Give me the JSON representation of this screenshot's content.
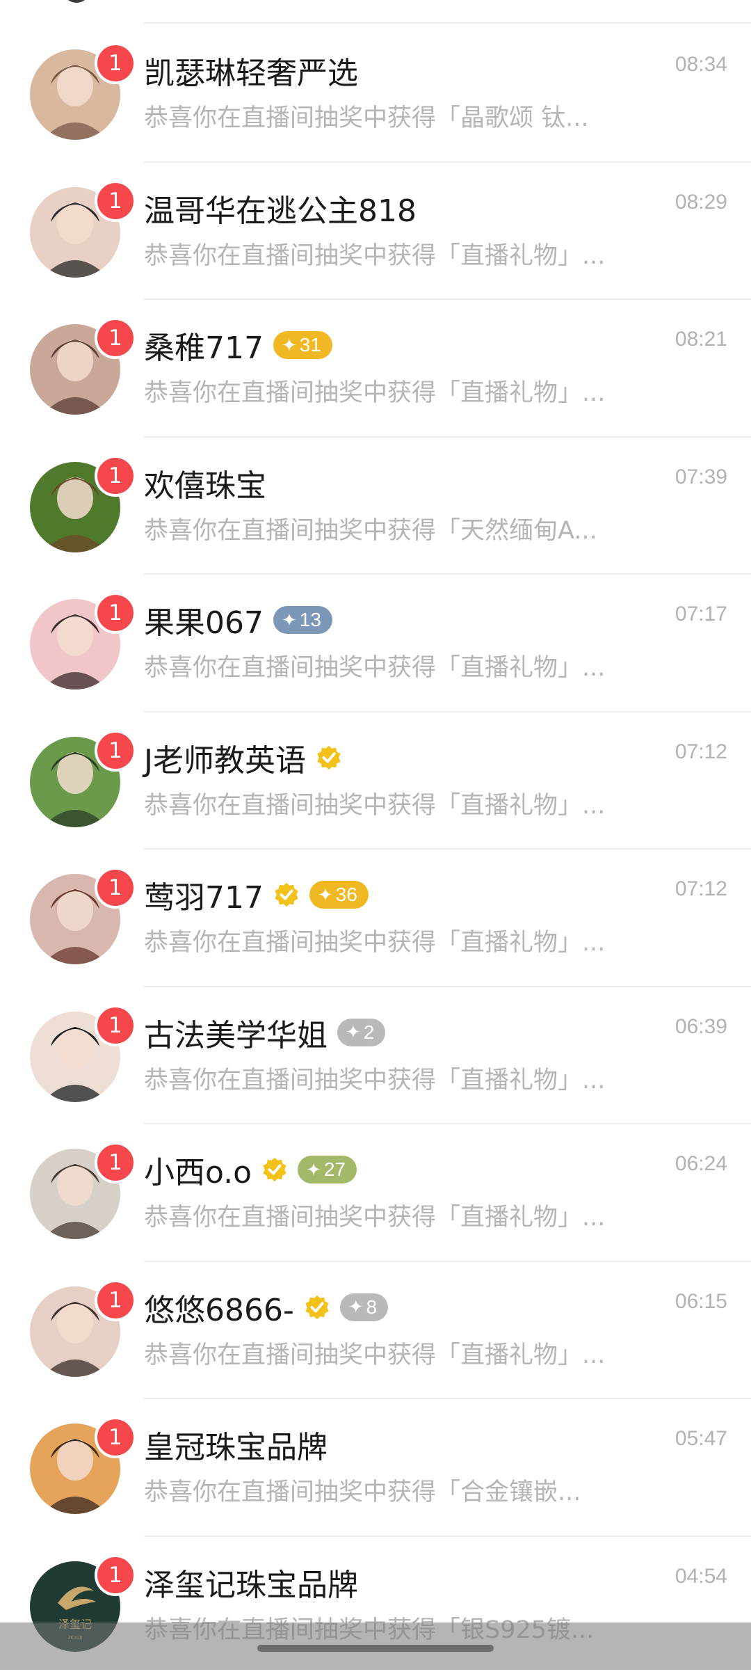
{
  "conversations": [
    {
      "name": "凯瑟琳轻奢严选",
      "time": "08:34",
      "preview": "恭喜你在直播间抽奖中获得「晶歌颂 钛...",
      "unread": "1",
      "verified": false,
      "level": null,
      "avatar_colors": [
        "#d9b8a0",
        "#7a5a48"
      ]
    },
    {
      "name": "温哥华在逃公主818",
      "time": "08:29",
      "preview": "恭喜你在直播间抽奖中获得「直播礼物」...",
      "unread": "1",
      "verified": false,
      "level": null,
      "avatar_colors": [
        "#e8d0c4",
        "#2a2a2a"
      ]
    },
    {
      "name": "桑稚717",
      "time": "08:21",
      "preview": "恭喜你在直播间抽奖中获得「直播礼物」...",
      "unread": "1",
      "verified": false,
      "level": {
        "value": "31",
        "color": "#f0b923"
      },
      "avatar_colors": [
        "#c9a89a",
        "#5a3e36"
      ]
    },
    {
      "name": "欢僖珠宝",
      "time": "07:39",
      "preview": "恭喜你在直播间抽奖中获得「天然缅甸A...",
      "unread": "1",
      "verified": false,
      "level": null,
      "avatar_colors": [
        "#4f7a2c",
        "#6b4a2a"
      ]
    },
    {
      "name": "果果067",
      "time": "07:17",
      "preview": "恭喜你在直播间抽奖中获得「直播礼物」...",
      "unread": "1",
      "verified": false,
      "level": {
        "value": "13",
        "color": "#7d97b8"
      },
      "avatar_colors": [
        "#f0c6c9",
        "#3a2a2a"
      ]
    },
    {
      "name": "J老师教英语",
      "time": "07:12",
      "preview": "恭喜你在直播间抽奖中获得「直播礼物」...",
      "unread": "1",
      "verified": true,
      "level": null,
      "avatar_colors": [
        "#6a9a4a",
        "#2e3e2a"
      ]
    },
    {
      "name": "莺羽717",
      "time": "07:12",
      "preview": "恭喜你在直播间抽奖中获得「直播礼物」...",
      "unread": "1",
      "verified": true,
      "level": {
        "value": "36",
        "color": "#f0b923"
      },
      "avatar_colors": [
        "#d8b7ae",
        "#6a3a30"
      ]
    },
    {
      "name": "古法美学华姐",
      "time": "06:39",
      "preview": "恭喜你在直播间抽奖中获得「直播礼物」...",
      "unread": "1",
      "verified": false,
      "level": {
        "value": "2",
        "color": "#b9b9b9"
      },
      "avatar_colors": [
        "#eeded6",
        "#1f1f1f"
      ]
    },
    {
      "name": "小西o.o",
      "time": "06:24",
      "preview": "恭喜你在直播间抽奖中获得「直播礼物」...",
      "unread": "1",
      "verified": true,
      "level": {
        "value": "27",
        "color": "#a4b86a"
      },
      "avatar_colors": [
        "#d6d0c8",
        "#4a3d35"
      ]
    },
    {
      "name": "悠悠6866-",
      "time": "06:15",
      "preview": "恭喜你在直播间抽奖中获得「直播礼物」...",
      "unread": "1",
      "verified": true,
      "level": {
        "value": "8",
        "color": "#b9b9b9"
      },
      "avatar_colors": [
        "#e6cfc4",
        "#3a2e2a"
      ]
    },
    {
      "name": "皇冠珠宝品牌",
      "time": "05:47",
      "preview": "恭喜你在直播间抽奖中获得「合金镶嵌...",
      "unread": "1",
      "verified": false,
      "level": null,
      "avatar_colors": [
        "#e5a45a",
        "#3a2a22"
      ]
    },
    {
      "name": "泽玺记珠宝品牌",
      "time": "04:54",
      "preview": "恭喜你在直播间抽奖中获得「银S925镀...",
      "unread": "1",
      "verified": false,
      "level": null,
      "avatar_colors": [
        "#1f3b33",
        "#c8a86a"
      ],
      "logo_text": "泽玺记",
      "logo_sub": "ZEXIJI"
    }
  ],
  "colors": {
    "unread_badge": "#f5474c",
    "verified": "#f2c21b",
    "divider": "#ececec"
  }
}
